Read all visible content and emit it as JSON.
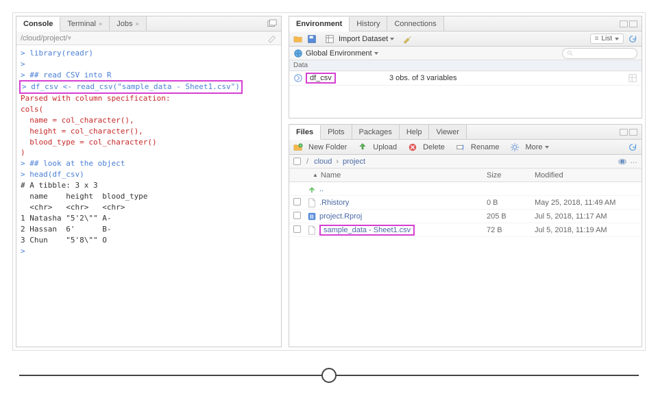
{
  "console": {
    "tabs": {
      "console": "Console",
      "terminal": "Terminal",
      "jobs": "Jobs"
    },
    "path": "/cloud/project/",
    "lines": [
      {
        "cls": "r-input",
        "text": "> library(readr)"
      },
      {
        "cls": "prompt",
        "text": ">"
      },
      {
        "cls": "r-input",
        "text": "> ## read CSV into R"
      },
      {
        "cls": "r-input hl",
        "text": "> df_csv <- read_csv(\"sample_data - Sheet1.csv\")"
      },
      {
        "cls": "r-msg",
        "text": "Parsed with column specification:"
      },
      {
        "cls": "r-msg",
        "text": "cols("
      },
      {
        "cls": "r-msg",
        "text": "  name = col_character(),"
      },
      {
        "cls": "r-msg",
        "text": "  height = col_character(),"
      },
      {
        "cls": "r-msg",
        "text": "  blood_type = col_character()"
      },
      {
        "cls": "r-msg",
        "text": ")"
      },
      {
        "cls": "r-input",
        "text": "> ## look at the object"
      },
      {
        "cls": "r-input",
        "text": "> head(df_csv)"
      },
      {
        "cls": "r-output",
        "text": "# A tibble: 3 x 3"
      },
      {
        "cls": "r-output",
        "text": "  name    height  blood_type"
      },
      {
        "cls": "r-output",
        "text": "  <chr>   <chr>   <chr>"
      },
      {
        "cls": "r-output",
        "text": "1 Natasha \"5'2\\\"\" A-"
      },
      {
        "cls": "r-output",
        "text": "2 Hassan  6'      B-"
      },
      {
        "cls": "r-output",
        "text": "3 Chun    \"5'8\\\"\" O"
      },
      {
        "cls": "prompt",
        "text": ">"
      }
    ]
  },
  "env": {
    "tabs": {
      "environment": "Environment",
      "history": "History",
      "connections": "Connections"
    },
    "import_label": "Import Dataset",
    "list_label": "List",
    "scope": "Global Environment",
    "section": "Data",
    "var_name": "df_csv",
    "var_desc": "3 obs. of 3 variables"
  },
  "files": {
    "tabs": {
      "files": "Files",
      "plots": "Plots",
      "packages": "Packages",
      "help": "Help",
      "viewer": "Viewer"
    },
    "toolbar": {
      "new_folder": "New Folder",
      "upload": "Upload",
      "delete": "Delete",
      "rename": "Rename",
      "more": "More"
    },
    "path_segments": [
      "cloud",
      "project"
    ],
    "headers": {
      "name": "Name",
      "size": "Size",
      "modified": "Modified"
    },
    "rows": [
      {
        "icon": "up",
        "name": "..",
        "size": "",
        "mod": "",
        "hl": false
      },
      {
        "icon": "file",
        "name": ".Rhistory",
        "size": "0 B",
        "mod": "May 25, 2018, 11:49 AM",
        "hl": false
      },
      {
        "icon": "rproj",
        "name": "project.Rproj",
        "size": "205 B",
        "mod": "Jul 5, 2018, 11:17 AM",
        "hl": false
      },
      {
        "icon": "file",
        "name": "sample_data - Sheet1.csv",
        "size": "72 B",
        "mod": "Jul 5, 2018, 11:19 AM",
        "hl": true
      }
    ]
  }
}
